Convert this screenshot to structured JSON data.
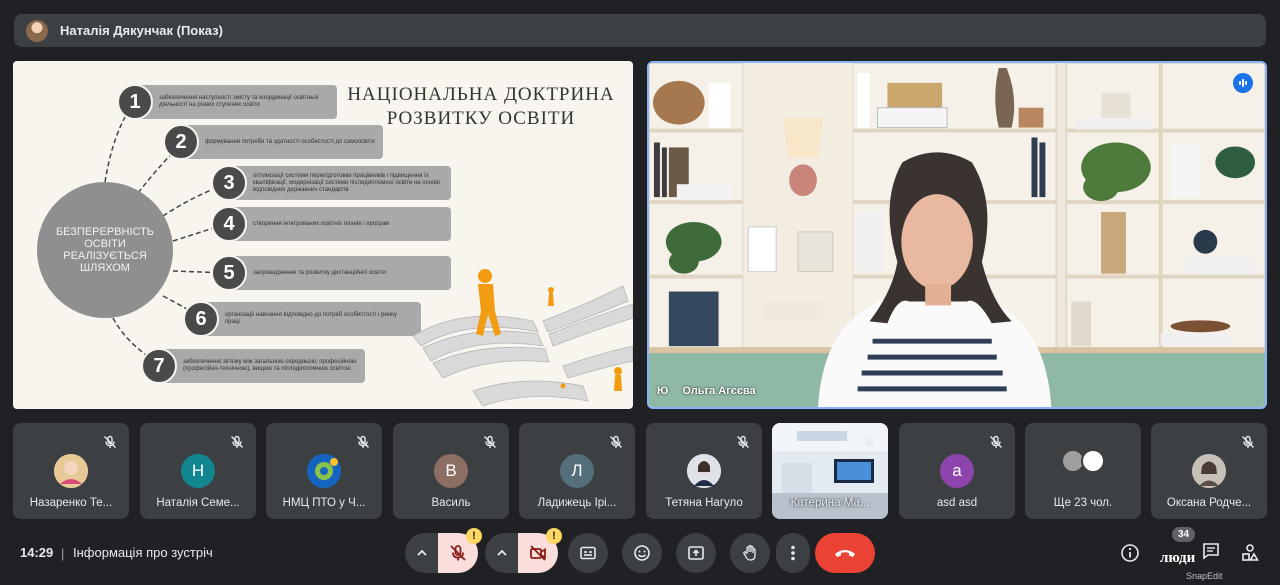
{
  "presenter_bar": {
    "title": "Наталія Дякунчак (Показ)"
  },
  "slide": {
    "headline_line1": "НАЦІОНАЛЬНА ДОКТРИНА",
    "headline_line2": "РОЗВИТКУ ОСВІТИ",
    "hub_text": "БЕЗПЕРЕРВНІСТЬ ОСВІТИ РЕАЛІЗУЄТЬСЯ ШЛЯХОМ",
    "items": [
      {
        "num": "1",
        "text": "забезпечення наступності змісту та координації освітньої діяльності на різних ступенях освіти"
      },
      {
        "num": "2",
        "text": "формування потреби та здатності особистості до самоосвіти"
      },
      {
        "num": "3",
        "text": "оптимізації системи перепідготовки працівників і підвищення їх кваліфікації, модернізації системи післядипломної освіти на основі відповідних державних стандартів"
      },
      {
        "num": "4",
        "text": "створення інтегрованих освітніх планів і програм"
      },
      {
        "num": "5",
        "text": "запровадження та розвитку дистанційної освіти"
      },
      {
        "num": "6",
        "text": "організації навчання відповідно до потреб особистості і ринку праці"
      },
      {
        "num": "7",
        "text": "забезпечення зв'язку між загальною середньою, професійною (професійно-технічною), вищою та післядипломною освітою"
      }
    ]
  },
  "main_video": {
    "name": "Ольга Агєєва",
    "pin_label": "Ю"
  },
  "participants": [
    {
      "name": "Назаренко Те...",
      "avatar_type": "photo",
      "color": "#d9b98a"
    },
    {
      "name": "Наталія Семе...",
      "avatar_type": "letter",
      "letter": "Н",
      "color": "#12868f"
    },
    {
      "name": "НМЦ ПТО у Ч...",
      "avatar_type": "logo",
      "color": "#1e88e5"
    },
    {
      "name": "Василь",
      "avatar_type": "letter",
      "letter": "В",
      "color": "#8d6e63"
    },
    {
      "name": "Ладижець Ірі...",
      "avatar_type": "letter",
      "letter": "Л",
      "color": "#546e7a"
    },
    {
      "name": "Тетяна Нагуло",
      "avatar_type": "photo",
      "color": "#c7cbd1"
    },
    {
      "name": "Катерина Ма...",
      "avatar_type": "video",
      "color": "#dfe6ee"
    },
    {
      "name": "asd asd",
      "avatar_type": "letter",
      "letter": "a",
      "color": "#8e44ad"
    },
    {
      "name": "Ще 23 чол.",
      "avatar_type": "group",
      "color": "#9e9e9e"
    },
    {
      "name": "Оксана Родче...",
      "avatar_type": "photo",
      "color": "#a8a29b"
    }
  ],
  "bottom_bar": {
    "time": "14:29",
    "separator": "|",
    "meeting_info": "Інформація про зустріч",
    "warning_mark": "!",
    "people_count": "34",
    "people_label": "люди",
    "watermark": "SnapEdit"
  },
  "colors": {
    "accent": "#8ab4f8",
    "end_call": "#ea4335",
    "muted_bg": "#f9dedc",
    "warning": "#fdd663"
  }
}
